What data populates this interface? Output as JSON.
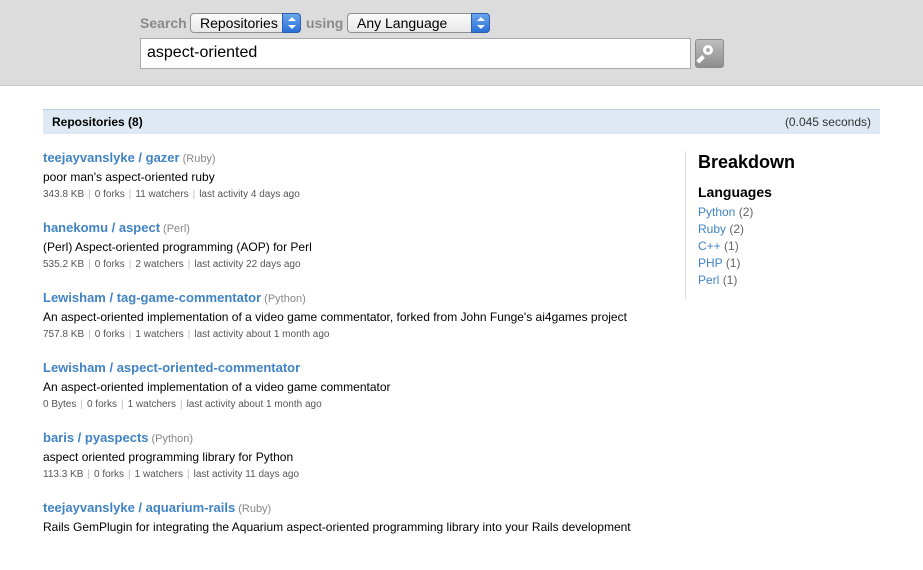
{
  "search": {
    "label": "Search",
    "scope_value": "Repositories",
    "using_label": "using",
    "language_value": "Any Language",
    "query": "aspect-oriented"
  },
  "results_header": {
    "count_label": "Repositories (8)",
    "time_label": "(0.045 seconds)"
  },
  "results": [
    {
      "name": "teejayvanslyke / gazer",
      "language": "(Ruby)",
      "description": "poor man's aspect-oriented ruby",
      "size": "343.8 KB",
      "forks": "0 forks",
      "watchers": "11 watchers",
      "activity": "last activity 4 days ago"
    },
    {
      "name": "hanekomu / aspect",
      "language": "(Perl)",
      "description": "(Perl) Aspect-oriented programming (AOP) for Perl",
      "size": "535.2 KB",
      "forks": "0 forks",
      "watchers": "2 watchers",
      "activity": "last activity 22 days ago"
    },
    {
      "name": "Lewisham / tag-game-commentator",
      "language": "(Python)",
      "description": "An aspect-oriented implementation of a video game commentator, forked from John Funge's ai4games project",
      "size": "757.8 KB",
      "forks": "0 forks",
      "watchers": "1 watchers",
      "activity": "last activity about 1 month ago"
    },
    {
      "name": "Lewisham / aspect-oriented-commentator",
      "language": "",
      "description": "An aspect-oriented implementation of a video game commentator",
      "size": "0 Bytes",
      "forks": "0 forks",
      "watchers": "1 watchers",
      "activity": "last activity about 1 month ago"
    },
    {
      "name": "baris / pyaspects",
      "language": "(Python)",
      "description": "aspect oriented programming library for Python",
      "size": "113.3 KB",
      "forks": "0 forks",
      "watchers": "1 watchers",
      "activity": "last activity 11 days ago"
    },
    {
      "name": "teejayvanslyke / aquarium-rails",
      "language": "(Ruby)",
      "description": "Rails GemPlugin for integrating the Aquarium aspect-oriented programming library into your Rails development",
      "size": "",
      "forks": "",
      "watchers": "",
      "activity": ""
    }
  ],
  "breakdown": {
    "title": "Breakdown",
    "languages_heading": "Languages",
    "languages": [
      {
        "name": "Python",
        "count": "(2)"
      },
      {
        "name": "Ruby",
        "count": "(2)"
      },
      {
        "name": "C++",
        "count": "(1)"
      },
      {
        "name": "PHP",
        "count": "(1)"
      },
      {
        "name": "Perl",
        "count": "(1)"
      }
    ]
  },
  "colors": {
    "link": "#4183c4",
    "search_bg": "#dcdcdc",
    "header_bg": "#dfe9f3"
  }
}
